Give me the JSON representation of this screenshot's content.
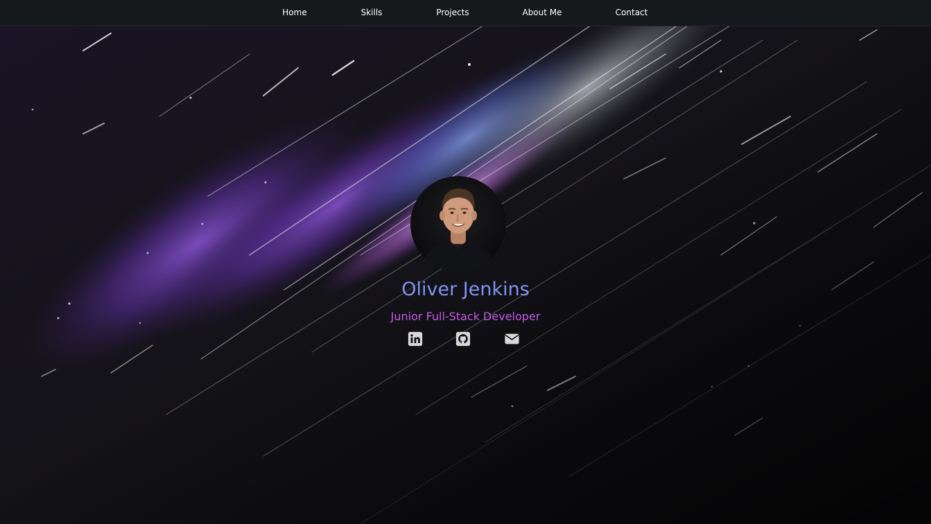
{
  "nav": {
    "items": [
      {
        "label": "Home"
      },
      {
        "label": "Skills"
      },
      {
        "label": "Projects"
      },
      {
        "label": "About Me"
      },
      {
        "label": "Contact"
      }
    ]
  },
  "profile": {
    "name": "Oliver Jenkins",
    "role": "Junior Full-Stack Developer",
    "avatar_alt": "Oliver Jenkins portrait"
  },
  "social": [
    {
      "icon": "linkedin-icon"
    },
    {
      "icon": "github-icon"
    },
    {
      "icon": "envelope-icon"
    }
  ],
  "colors": {
    "nav_bg": "#16191c",
    "name": "#7e95f0",
    "role": "#c65be6",
    "icon": "#d8d8d8",
    "background": "#0b0b0e"
  }
}
